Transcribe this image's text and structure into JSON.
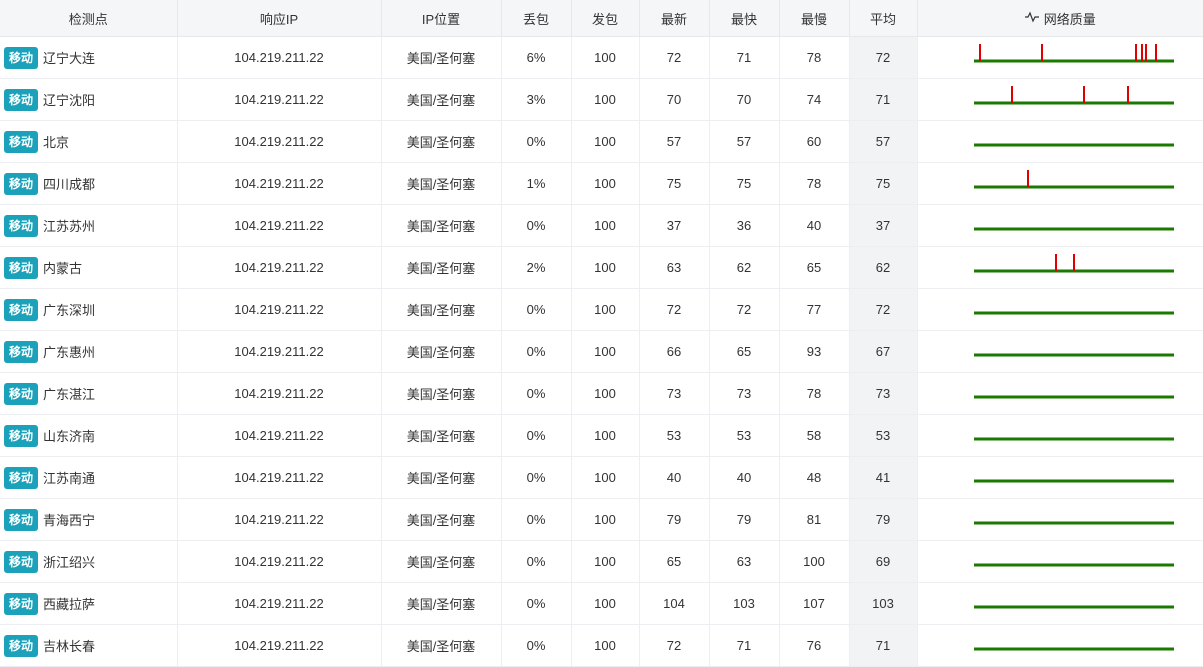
{
  "header": {
    "node": "检测点",
    "ip": "响应IP",
    "location": "IP位置",
    "loss": "丢包",
    "sent": "发包",
    "latest": "最新",
    "fastest": "最快",
    "slowest": "最慢",
    "avg": "平均",
    "quality": "网络质量",
    "quality_icon": "pulse-icon"
  },
  "colors": {
    "isp_badge": "#1ba2ba",
    "quality_ok": "#1a7a00",
    "quality_loss": "#e00000"
  },
  "rows": [
    {
      "isp": "移动",
      "node": "辽宁大连",
      "ip": "104.219.211.22",
      "location": "美国/圣何塞",
      "loss": "6%",
      "sent": "100",
      "latest": "72",
      "fastest": "71",
      "slowest": "78",
      "avg": "72",
      "loss_marks": [
        0.03,
        0.34,
        0.81,
        0.84,
        0.86,
        0.91
      ]
    },
    {
      "isp": "移动",
      "node": "辽宁沈阳",
      "ip": "104.219.211.22",
      "location": "美国/圣何塞",
      "loss": "3%",
      "sent": "100",
      "latest": "70",
      "fastest": "70",
      "slowest": "74",
      "avg": "71",
      "loss_marks": [
        0.19,
        0.55,
        0.77
      ]
    },
    {
      "isp": "移动",
      "node": "北京",
      "ip": "104.219.211.22",
      "location": "美国/圣何塞",
      "loss": "0%",
      "sent": "100",
      "latest": "57",
      "fastest": "57",
      "slowest": "60",
      "avg": "57",
      "loss_marks": []
    },
    {
      "isp": "移动",
      "node": "四川成都",
      "ip": "104.219.211.22",
      "location": "美国/圣何塞",
      "loss": "1%",
      "sent": "100",
      "latest": "75",
      "fastest": "75",
      "slowest": "78",
      "avg": "75",
      "loss_marks": [
        0.27
      ]
    },
    {
      "isp": "移动",
      "node": "江苏苏州",
      "ip": "104.219.211.22",
      "location": "美国/圣何塞",
      "loss": "0%",
      "sent": "100",
      "latest": "37",
      "fastest": "36",
      "slowest": "40",
      "avg": "37",
      "loss_marks": []
    },
    {
      "isp": "移动",
      "node": "内蒙古",
      "ip": "104.219.211.22",
      "location": "美国/圣何塞",
      "loss": "2%",
      "sent": "100",
      "latest": "63",
      "fastest": "62",
      "slowest": "65",
      "avg": "62",
      "loss_marks": [
        0.41,
        0.5
      ]
    },
    {
      "isp": "移动",
      "node": "广东深圳",
      "ip": "104.219.211.22",
      "location": "美国/圣何塞",
      "loss": "0%",
      "sent": "100",
      "latest": "72",
      "fastest": "72",
      "slowest": "77",
      "avg": "72",
      "loss_marks": []
    },
    {
      "isp": "移动",
      "node": "广东惠州",
      "ip": "104.219.211.22",
      "location": "美国/圣何塞",
      "loss": "0%",
      "sent": "100",
      "latest": "66",
      "fastest": "65",
      "slowest": "93",
      "avg": "67",
      "loss_marks": []
    },
    {
      "isp": "移动",
      "node": "广东湛江",
      "ip": "104.219.211.22",
      "location": "美国/圣何塞",
      "loss": "0%",
      "sent": "100",
      "latest": "73",
      "fastest": "73",
      "slowest": "78",
      "avg": "73",
      "loss_marks": []
    },
    {
      "isp": "移动",
      "node": "山东济南",
      "ip": "104.219.211.22",
      "location": "美国/圣何塞",
      "loss": "0%",
      "sent": "100",
      "latest": "53",
      "fastest": "53",
      "slowest": "58",
      "avg": "53",
      "loss_marks": []
    },
    {
      "isp": "移动",
      "node": "江苏南通",
      "ip": "104.219.211.22",
      "location": "美国/圣何塞",
      "loss": "0%",
      "sent": "100",
      "latest": "40",
      "fastest": "40",
      "slowest": "48",
      "avg": "41",
      "loss_marks": []
    },
    {
      "isp": "移动",
      "node": "青海西宁",
      "ip": "104.219.211.22",
      "location": "美国/圣何塞",
      "loss": "0%",
      "sent": "100",
      "latest": "79",
      "fastest": "79",
      "slowest": "81",
      "avg": "79",
      "loss_marks": []
    },
    {
      "isp": "移动",
      "node": "浙江绍兴",
      "ip": "104.219.211.22",
      "location": "美国/圣何塞",
      "loss": "0%",
      "sent": "100",
      "latest": "65",
      "fastest": "63",
      "slowest": "100",
      "avg": "69",
      "loss_marks": []
    },
    {
      "isp": "移动",
      "node": "西藏拉萨",
      "ip": "104.219.211.22",
      "location": "美国/圣何塞",
      "loss": "0%",
      "sent": "100",
      "latest": "104",
      "fastest": "103",
      "slowest": "107",
      "avg": "103",
      "loss_marks": []
    },
    {
      "isp": "移动",
      "node": "吉林长春",
      "ip": "104.219.211.22",
      "location": "美国/圣何塞",
      "loss": "0%",
      "sent": "100",
      "latest": "72",
      "fastest": "71",
      "slowest": "76",
      "avg": "71",
      "loss_marks": []
    }
  ]
}
